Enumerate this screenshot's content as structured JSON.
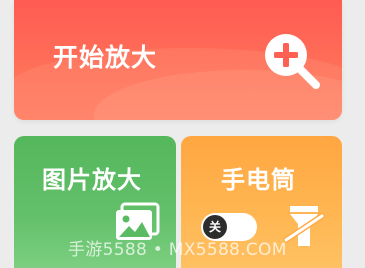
{
  "cards": {
    "start_zoom": {
      "label": "开始放大",
      "icon": "zoom-in-icon",
      "color": "#ff6054"
    },
    "picture_zoom": {
      "label": "图片放大",
      "icon": "gallery-icon",
      "color": "#5bbb62"
    },
    "flashlight": {
      "label": "手电筒",
      "icon": "flashlight-off-icon",
      "color": "#ffac48",
      "toggle_state": "关"
    }
  },
  "watermark": "手游5588 • MX5588.COM"
}
